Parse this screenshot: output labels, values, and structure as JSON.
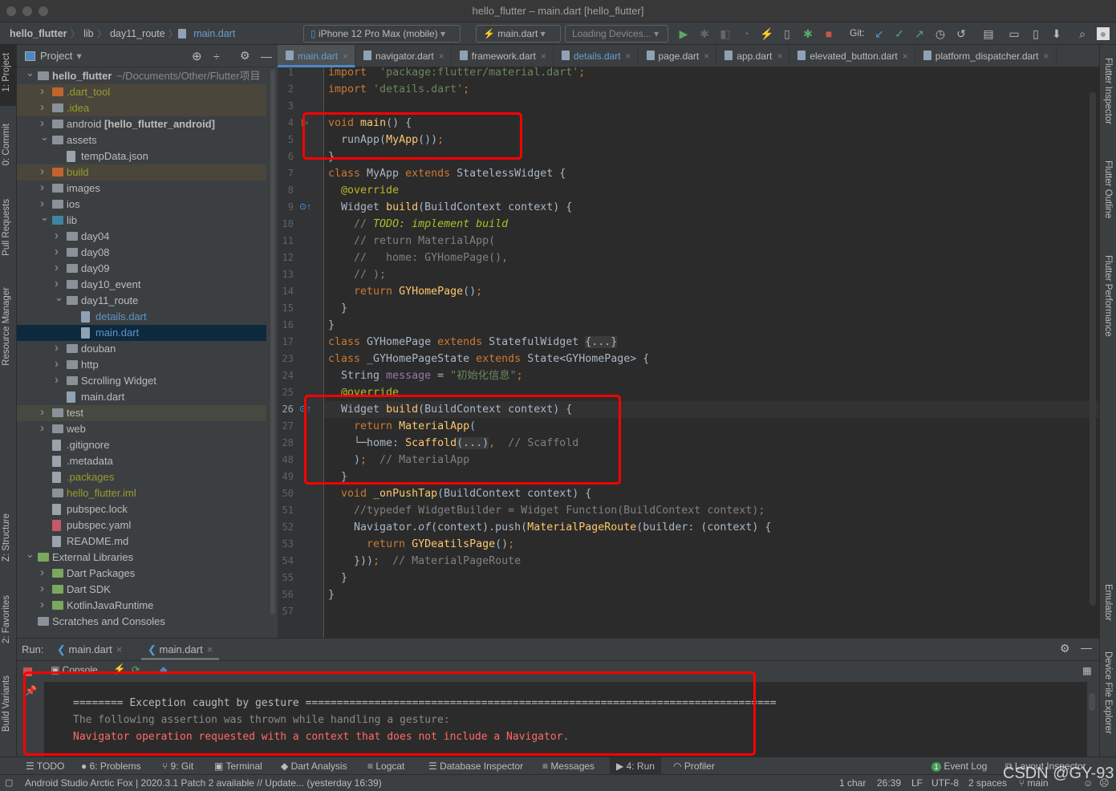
{
  "window": {
    "title": "hello_flutter – main.dart [hello_flutter]"
  },
  "breadcrumb": [
    "hello_flutter",
    "lib",
    "day11_route",
    "main.dart"
  ],
  "toolbar": {
    "device": "iPhone 12 Pro Max (mobile)",
    "config": "main.dart",
    "loading_devices": "Loading Devices...",
    "git_label": "Git:"
  },
  "left_strip": [
    "1: Project",
    "0: Commit",
    "Pull Requests",
    "Resource Manager",
    "Z: Structure",
    "2: Favorites",
    "Build Variants"
  ],
  "right_strip": [
    "Flutter Inspector",
    "Flutter Outline",
    "Flutter Performance",
    "Emulator",
    "Device File Explorer"
  ],
  "project": {
    "title": "Project",
    "tree": [
      {
        "level": 0,
        "name": "hello_flutter",
        "suffix": " ~/Documents/Other/Flutter项目",
        "arrow": "open",
        "bold": true,
        "icon": "module"
      },
      {
        "level": 1,
        "name": ".dart_tool",
        "arrow": "closed",
        "color": "#9b9b2d",
        "bg": "#4a463c",
        "icon": "folder-orange"
      },
      {
        "level": 1,
        "name": ".idea",
        "arrow": "closed",
        "color": "#9b9b2d",
        "bg": "#4a463c",
        "icon": "folder"
      },
      {
        "level": 1,
        "name": "android ",
        "suffix": "[hello_flutter_android]",
        "arrow": "closed",
        "icon": "module"
      },
      {
        "level": 1,
        "name": "assets",
        "arrow": "open",
        "icon": "folder"
      },
      {
        "level": 2,
        "name": "tempData.json",
        "icon": "file"
      },
      {
        "level": 1,
        "name": "build",
        "arrow": "closed",
        "color": "#9b9b2d",
        "bg": "#4a463c",
        "icon": "folder-orange"
      },
      {
        "level": 1,
        "name": "images",
        "arrow": "closed",
        "icon": "folder"
      },
      {
        "level": 1,
        "name": "ios",
        "arrow": "closed",
        "icon": "folder"
      },
      {
        "level": 1,
        "name": "lib",
        "arrow": "open",
        "icon": "folder-blue"
      },
      {
        "level": 2,
        "name": "day04",
        "arrow": "closed",
        "icon": "package"
      },
      {
        "level": 2,
        "name": "day08",
        "arrow": "closed",
        "icon": "package"
      },
      {
        "level": 2,
        "name": "day09",
        "arrow": "closed",
        "icon": "package"
      },
      {
        "level": 2,
        "name": "day10_event",
        "arrow": "closed",
        "icon": "package"
      },
      {
        "level": 2,
        "name": "day11_route",
        "arrow": "open",
        "icon": "package"
      },
      {
        "level": 3,
        "name": "details.dart",
        "color": "#5f93c9",
        "icon": "dart"
      },
      {
        "level": 3,
        "name": "main.dart",
        "color": "#5f93c9",
        "bg": "#0d293e",
        "icon": "dart",
        "selected": true
      },
      {
        "level": 2,
        "name": "douban",
        "arrow": "closed",
        "icon": "package"
      },
      {
        "level": 2,
        "name": "http",
        "arrow": "closed",
        "icon": "package"
      },
      {
        "level": 2,
        "name": "Scrolling Widget",
        "arrow": "closed",
        "icon": "folder"
      },
      {
        "level": 2,
        "name": "main.dart",
        "icon": "dart"
      },
      {
        "level": 1,
        "name": "test",
        "arrow": "closed",
        "bg": "#45493f",
        "icon": "folder-test"
      },
      {
        "level": 1,
        "name": "web",
        "arrow": "closed",
        "icon": "folder"
      },
      {
        "level": 1,
        "name": ".gitignore",
        "icon": "file"
      },
      {
        "level": 1,
        "name": ".metadata",
        "icon": "file"
      },
      {
        "level": 1,
        "name": ".packages",
        "color": "#9b9b2d",
        "icon": "file"
      },
      {
        "level": 1,
        "name": "hello_flutter.iml",
        "color": "#9b9b2d",
        "icon": "module"
      },
      {
        "level": 1,
        "name": "pubspec.lock",
        "icon": "file"
      },
      {
        "level": 1,
        "name": "pubspec.yaml",
        "icon": "yaml"
      },
      {
        "level": 1,
        "name": "README.md",
        "icon": "file"
      },
      {
        "level": 0,
        "name": "External Libraries",
        "arrow": "open",
        "icon": "library"
      },
      {
        "level": 1,
        "name": "Dart Packages",
        "arrow": "closed",
        "icon": "library"
      },
      {
        "level": 1,
        "name": "Dart SDK",
        "arrow": "closed",
        "icon": "library"
      },
      {
        "level": 1,
        "name": "KotlinJavaRuntime",
        "arrow": "closed",
        "icon": "library"
      },
      {
        "level": 0,
        "name": "Scratches and Consoles",
        "icon": "scratch"
      }
    ]
  },
  "editor": {
    "tabs": [
      {
        "label": "main.dart",
        "active": true
      },
      {
        "label": "navigator.dart"
      },
      {
        "label": "framework.dart"
      },
      {
        "label": "details.dart",
        "blue": true
      },
      {
        "label": "page.dart"
      },
      {
        "label": "app.dart"
      },
      {
        "label": "elevated_button.dart"
      },
      {
        "label": "platform_dispatcher.dart"
      }
    ],
    "current_line": 26,
    "lines": [
      {
        "n": 1,
        "t": [
          [
            "kw",
            "import"
          ],
          [
            "",
            "  "
          ],
          [
            "str",
            "'package:flutter/material.dart'"
          ],
          [
            "kw",
            ";"
          ]
        ]
      },
      {
        "n": 2,
        "t": [
          [
            "kw",
            "import"
          ],
          [
            "",
            ""
          ],
          [
            "str",
            " 'details.dart'"
          ],
          [
            "kw",
            ";"
          ]
        ]
      },
      {
        "n": 3,
        "t": []
      },
      {
        "n": 4,
        "t": [
          [
            "kw",
            "void"
          ],
          [
            "",
            " "
          ],
          [
            "fn",
            "main"
          ],
          [
            "",
            "() {"
          ]
        ]
      },
      {
        "n": 5,
        "t": [
          [
            "",
            "  runApp("
          ],
          [
            "fn",
            "MyApp"
          ],
          [
            "",
            "())"
          ],
          [
            "kw",
            ";"
          ]
        ]
      },
      {
        "n": 6,
        "t": [
          [
            "",
            "}"
          ]
        ]
      },
      {
        "n": 7,
        "t": [
          [
            "kw",
            "class"
          ],
          [
            "",
            " MyApp "
          ],
          [
            "kw",
            "extends"
          ],
          [
            "",
            " StatelessWidget {"
          ]
        ]
      },
      {
        "n": 8,
        "t": [
          [
            "",
            "  "
          ],
          [
            "an",
            "@override"
          ]
        ]
      },
      {
        "n": 9,
        "t": [
          [
            "",
            "  Widget "
          ],
          [
            "fn",
            "build"
          ],
          [
            "",
            "(BuildContext context) {"
          ]
        ]
      },
      {
        "n": 10,
        "t": [
          [
            "cm",
            "    // "
          ],
          [
            "todo",
            "TODO: implement build"
          ]
        ]
      },
      {
        "n": 11,
        "t": [
          [
            "cm",
            "    // return MaterialApp("
          ]
        ]
      },
      {
        "n": 12,
        "t": [
          [
            "cm",
            "    //   home: GYHomePage(),"
          ]
        ]
      },
      {
        "n": 13,
        "t": [
          [
            "cm",
            "    // );"
          ]
        ]
      },
      {
        "n": 14,
        "t": [
          [
            "",
            "    "
          ],
          [
            "kw",
            "return "
          ],
          [
            "fn",
            "GYHomePage"
          ],
          [
            "",
            "()"
          ],
          [
            "kw",
            ";"
          ]
        ]
      },
      {
        "n": 15,
        "t": [
          [
            "",
            "  }"
          ]
        ]
      },
      {
        "n": 16,
        "t": [
          [
            "",
            "}"
          ]
        ]
      },
      {
        "n": 17,
        "t": [
          [
            "kw",
            "class"
          ],
          [
            "",
            " GYHomePage "
          ],
          [
            "kw",
            "extends"
          ],
          [
            "",
            " StatefulWidget "
          ],
          [
            "fold",
            "{...}"
          ]
        ]
      },
      {
        "n": 23,
        "t": [
          [
            "kw",
            "class"
          ],
          [
            "",
            " _GYHomePageState "
          ],
          [
            "kw",
            "extends"
          ],
          [
            "",
            " State<GYHomePage> {"
          ]
        ]
      },
      {
        "n": 24,
        "t": [
          [
            "",
            "  String "
          ],
          [
            "fd",
            "message"
          ],
          [
            "",
            " = "
          ],
          [
            "str",
            "\"初始化信息\""
          ],
          [
            "kw",
            ";"
          ]
        ]
      },
      {
        "n": 25,
        "t": [
          [
            "",
            "  "
          ],
          [
            "an",
            "@override"
          ]
        ]
      },
      {
        "n": 26,
        "t": [
          [
            "",
            "  Widget "
          ],
          [
            "fn",
            "build"
          ],
          [
            "",
            "(BuildContext context) {"
          ]
        ]
      },
      {
        "n": 27,
        "t": [
          [
            "",
            "    "
          ],
          [
            "kw",
            "return "
          ],
          [
            "fn",
            "MaterialApp"
          ],
          [
            "",
            "("
          ]
        ]
      },
      {
        "n": 28,
        "t": [
          [
            "",
            "    └─home: "
          ],
          [
            "fn",
            "Scaffold"
          ],
          [
            "fold",
            "(...)"
          ],
          [
            "kw",
            ","
          ],
          [
            "cm",
            "  // Scaffold"
          ]
        ]
      },
      {
        "n": 48,
        "t": [
          [
            "",
            "    )"
          ],
          [
            "kw",
            ";"
          ],
          [
            "cm",
            "  // MaterialApp"
          ]
        ]
      },
      {
        "n": 49,
        "t": [
          [
            "",
            "  }"
          ]
        ]
      },
      {
        "n": 50,
        "t": [
          [
            "",
            "  "
          ],
          [
            "kw",
            "void "
          ],
          [
            "fn",
            "_onPushTap"
          ],
          [
            "",
            "(BuildContext context) {"
          ]
        ]
      },
      {
        "n": 51,
        "t": [
          [
            "cm",
            "    //typedef WidgetBuilder = Widget Function(BuildContext context);"
          ]
        ]
      },
      {
        "n": 52,
        "t": [
          [
            "",
            "    Navigator."
          ],
          [
            "it",
            "of"
          ],
          [
            "",
            "(context).push("
          ],
          [
            "fn",
            "MaterialPageRoute"
          ],
          [
            "",
            "(builder: (context) {"
          ]
        ]
      },
      {
        "n": 53,
        "t": [
          [
            "",
            "      "
          ],
          [
            "kw",
            "return "
          ],
          [
            "fn",
            "GYDeatilsPage"
          ],
          [
            "",
            "()"
          ],
          [
            "kw",
            ";"
          ]
        ]
      },
      {
        "n": 54,
        "t": [
          [
            "",
            "    }))"
          ],
          [
            "kw",
            ";"
          ],
          [
            "cm",
            "  // MaterialPageRoute"
          ]
        ]
      },
      {
        "n": 55,
        "t": [
          [
            "",
            "  }"
          ]
        ]
      },
      {
        "n": 56,
        "t": [
          [
            "",
            "}"
          ]
        ]
      },
      {
        "n": 57,
        "t": []
      }
    ]
  },
  "run": {
    "label": "Run:",
    "tabs": [
      "main.dart",
      "main.dart"
    ],
    "console_label": "Console",
    "output": [
      {
        "text": "======== Exception caught by gesture ===========================================================================",
        "color": "#bbbbbb"
      },
      {
        "text": "The following assertion was thrown while handling a gesture:",
        "color": "#8a8a8a"
      },
      {
        "text": "Navigator operation requested with a context that does not include a Navigator.",
        "color": "#ff6b68"
      }
    ]
  },
  "bottom_tabs": [
    "TODO",
    "6: Problems",
    "9: Git",
    "Terminal",
    "Dart Analysis",
    "Logcat",
    "Database Inspector",
    "Messages",
    "4: Run",
    "Profiler"
  ],
  "bottom_right": {
    "event_log": "Event Log",
    "event_count": "1",
    "layout_inspector": "Layout Inspector"
  },
  "status": {
    "message": "Android Studio Arctic Fox | 2020.3.1 Patch 2 available // Update... (yesterday 16:39)",
    "selection": "1 char",
    "position": "26:39",
    "line_sep": "LF",
    "encoding": "UTF-8",
    "indent": "2 spaces",
    "branch": "main"
  },
  "watermark": "CSDN @GY-93",
  "colors": {
    "highlight_box": "#ff0000",
    "keyword": "#cc7832",
    "string": "#6a8759",
    "function": "#ffc66d",
    "error": "#ff6b68",
    "selection": "#0d293e"
  }
}
